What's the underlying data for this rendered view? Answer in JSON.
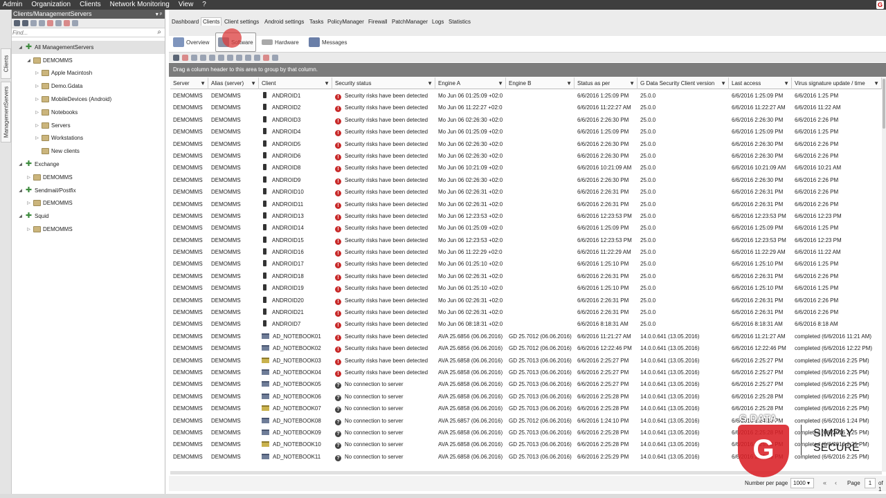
{
  "menubar": {
    "items": [
      "Admin",
      "Organization",
      "Clients",
      "Network Monitoring",
      "View",
      "?"
    ],
    "logo": "G"
  },
  "vtabs": [
    "Clients",
    "ManagementServers"
  ],
  "left_panel": {
    "title": "Clients/ManagementServers",
    "pin": "▾ ᵖ",
    "search_placeholder": "Find...",
    "tree": [
      {
        "label": "All ManagementServers",
        "depth": 0,
        "icon": "network-icon",
        "exp": "◢",
        "selected": true
      },
      {
        "label": "DEMOMMS",
        "depth": 1,
        "icon": "folder-icon",
        "exp": "◢"
      },
      {
        "label": "Apple Macintosh",
        "depth": 2,
        "icon": "folder-icon",
        "exp": "▷"
      },
      {
        "label": "Demo.Gdata",
        "depth": 2,
        "icon": "folder-icon",
        "exp": "▷"
      },
      {
        "label": "MobileDevices (Android)",
        "depth": 2,
        "icon": "folder-icon",
        "exp": "▷"
      },
      {
        "label": "Notebooks",
        "depth": 2,
        "icon": "folder-icon",
        "exp": "▷"
      },
      {
        "label": "Servers",
        "depth": 2,
        "icon": "folder-icon",
        "exp": "▷"
      },
      {
        "label": "Workstations",
        "depth": 2,
        "icon": "folder-icon",
        "exp": "▷"
      },
      {
        "label": "New clients",
        "depth": 2,
        "icon": "folder-icon",
        "exp": ""
      },
      {
        "label": "Exchange",
        "depth": 0,
        "icon": "network-icon",
        "exp": "◢"
      },
      {
        "label": "DEMOMMS",
        "depth": 1,
        "icon": "folder-icon",
        "exp": "▷"
      },
      {
        "label": "Sendmail/Postfix",
        "depth": 0,
        "icon": "network-icon",
        "exp": "◢"
      },
      {
        "label": "DEMOMMS",
        "depth": 1,
        "icon": "folder-icon",
        "exp": "▷"
      },
      {
        "label": "Squid",
        "depth": 0,
        "icon": "network-icon",
        "exp": "◢"
      },
      {
        "label": "DEMOMMS",
        "depth": 1,
        "icon": "folder-icon",
        "exp": "▷"
      }
    ]
  },
  "top_tabs": [
    "Dashboard",
    "Clients",
    "Client settings",
    "Android settings",
    "Tasks",
    "PolicyManager",
    "Firewall",
    "PatchManager",
    "Logs",
    "Statistics"
  ],
  "active_top_tab": "Clients",
  "sub_tabs": [
    "Overview",
    "Software",
    "Hardware",
    "Messages"
  ],
  "active_sub_tab": "Software",
  "group_bar": "Drag a column header to this area to group by that column.",
  "columns": [
    "Server",
    "Alias (server)",
    "Client",
    "Security status",
    "Engine A",
    "Engine B",
    "Status as per",
    "G Data Security Client version",
    "Last access",
    "Virus signature update / time"
  ],
  "rows": [
    [
      "DEMOMMS",
      "DEMOMMS",
      "ANDROID1",
      "Security risks have been detected",
      "Mo Jun 06 01:25:09 +02:0",
      "",
      "6/6/2016 1:25:09 PM",
      "25.0.0",
      "6/6/2016 1:25:09 PM",
      "6/6/2016 1:25 PM",
      "phone",
      "risk"
    ],
    [
      "DEMOMMS",
      "DEMOMMS",
      "ANDROID2",
      "Security risks have been detected",
      "Mo Jun 06 11:22:27 +02:0",
      "",
      "6/6/2016 11:22:27 AM",
      "25.0.0",
      "6/6/2016 11:22:27 AM",
      "6/6/2016 11:22 AM",
      "phone",
      "risk"
    ],
    [
      "DEMOMMS",
      "DEMOMMS",
      "ANDROID3",
      "Security risks have been detected",
      "Mo Jun 06 02:26:30 +02:0",
      "",
      "6/6/2016 2:26:30 PM",
      "25.0.0",
      "6/6/2016 2:26:30 PM",
      "6/6/2016 2:26 PM",
      "phone",
      "risk"
    ],
    [
      "DEMOMMS",
      "DEMOMMS",
      "ANDROID4",
      "Security risks have been detected",
      "Mo Jun 06 01:25:09 +02:0",
      "",
      "6/6/2016 1:25:09 PM",
      "25.0.0",
      "6/6/2016 1:25:09 PM",
      "6/6/2016 1:25 PM",
      "phone",
      "risk"
    ],
    [
      "DEMOMMS",
      "DEMOMMS",
      "ANDROID5",
      "Security risks have been detected",
      "Mo Jun 06 02:26:30 +02:0",
      "",
      "6/6/2016 2:26:30 PM",
      "25.0.0",
      "6/6/2016 2:26:30 PM",
      "6/6/2016 2:26 PM",
      "phone",
      "risk"
    ],
    [
      "DEMOMMS",
      "DEMOMMS",
      "ANDROID6",
      "Security risks have been detected",
      "Mo Jun 06 02:26:30 +02:0",
      "",
      "6/6/2016 2:26:30 PM",
      "25.0.0",
      "6/6/2016 2:26:30 PM",
      "6/6/2016 2:26 PM",
      "phone",
      "risk"
    ],
    [
      "DEMOMMS",
      "DEMOMMS",
      "ANDROID8",
      "Security risks have been detected",
      "Mo Jun 06 10:21:09 +02:0",
      "",
      "6/6/2016 10:21:09 AM",
      "25.0.0",
      "6/6/2016 10:21:09 AM",
      "6/6/2016 10:21 AM",
      "phone",
      "risk"
    ],
    [
      "DEMOMMS",
      "DEMOMMS",
      "ANDROID9",
      "Security risks have been detected",
      "Mo Jun 06 02:26:30 +02:0",
      "",
      "6/6/2016 2:26:30 PM",
      "25.0.0",
      "6/6/2016 2:26:30 PM",
      "6/6/2016 2:26 PM",
      "phone",
      "risk"
    ],
    [
      "DEMOMMS",
      "DEMOMMS",
      "ANDROID10",
      "Security risks have been detected",
      "Mo Jun 06 02:26:31 +02:0",
      "",
      "6/6/2016 2:26:31 PM",
      "25.0.0",
      "6/6/2016 2:26:31 PM",
      "6/6/2016 2:26 PM",
      "phone",
      "risk"
    ],
    [
      "DEMOMMS",
      "DEMOMMS",
      "ANDROID11",
      "Security risks have been detected",
      "Mo Jun 06 02:26:31 +02:0",
      "",
      "6/6/2016 2:26:31 PM",
      "25.0.0",
      "6/6/2016 2:26:31 PM",
      "6/6/2016 2:26 PM",
      "phone",
      "risk"
    ],
    [
      "DEMOMMS",
      "DEMOMMS",
      "ANDROID13",
      "Security risks have been detected",
      "Mo Jun 06 12:23:53 +02:0",
      "",
      "6/6/2016 12:23:53 PM",
      "25.0.0",
      "6/6/2016 12:23:53 PM",
      "6/6/2016 12:23 PM",
      "phone",
      "risk"
    ],
    [
      "DEMOMMS",
      "DEMOMMS",
      "ANDROID14",
      "Security risks have been detected",
      "Mo Jun 06 01:25:09 +02:0",
      "",
      "6/6/2016 1:25:09 PM",
      "25.0.0",
      "6/6/2016 1:25:09 PM",
      "6/6/2016 1:25 PM",
      "phone",
      "risk"
    ],
    [
      "DEMOMMS",
      "DEMOMMS",
      "ANDROID15",
      "Security risks have been detected",
      "Mo Jun 06 12:23:53 +02:0",
      "",
      "6/6/2016 12:23:53 PM",
      "25.0.0",
      "6/6/2016 12:23:53 PM",
      "6/6/2016 12:23 PM",
      "phone",
      "risk"
    ],
    [
      "DEMOMMS",
      "DEMOMMS",
      "ANDROID16",
      "Security risks have been detected",
      "Mo Jun 06 11:22:29 +02:0",
      "",
      "6/6/2016 11:22:29 AM",
      "25.0.0",
      "6/6/2016 11:22:29 AM",
      "6/6/2016 11:22 AM",
      "phone",
      "risk"
    ],
    [
      "DEMOMMS",
      "DEMOMMS",
      "ANDROID17",
      "Security risks have been detected",
      "Mo Jun 06 01:25:10 +02:0",
      "",
      "6/6/2016 1:25:10 PM",
      "25.0.0",
      "6/6/2016 1:25:10 PM",
      "6/6/2016 1:25 PM",
      "phone",
      "risk"
    ],
    [
      "DEMOMMS",
      "DEMOMMS",
      "ANDROID18",
      "Security risks have been detected",
      "Mo Jun 06 02:26:31 +02:0",
      "",
      "6/6/2016 2:26:31 PM",
      "25.0.0",
      "6/6/2016 2:26:31 PM",
      "6/6/2016 2:26 PM",
      "phone",
      "risk"
    ],
    [
      "DEMOMMS",
      "DEMOMMS",
      "ANDROID19",
      "Security risks have been detected",
      "Mo Jun 06 01:25:10 +02:0",
      "",
      "6/6/2016 1:25:10 PM",
      "25.0.0",
      "6/6/2016 1:25:10 PM",
      "6/6/2016 1:25 PM",
      "phone",
      "risk"
    ],
    [
      "DEMOMMS",
      "DEMOMMS",
      "ANDROID20",
      "Security risks have been detected",
      "Mo Jun 06 02:26:31 +02:0",
      "",
      "6/6/2016 2:26:31 PM",
      "25.0.0",
      "6/6/2016 2:26:31 PM",
      "6/6/2016 2:26 PM",
      "phone",
      "risk"
    ],
    [
      "DEMOMMS",
      "DEMOMMS",
      "ANDROID21",
      "Security risks have been detected",
      "Mo Jun 06 02:26:31 +02:0",
      "",
      "6/6/2016 2:26:31 PM",
      "25.0.0",
      "6/6/2016 2:26:31 PM",
      "6/6/2016 2:26 PM",
      "phone",
      "risk"
    ],
    [
      "DEMOMMS",
      "DEMOMMS",
      "ANDROID7",
      "Security risks have been detected",
      "Mo Jun 06 08:18:31 +02:0",
      "",
      "6/6/2016 8:18:31 AM",
      "25.0.0",
      "6/6/2016 8:18:31 AM",
      "6/6/2016 8:18 AM",
      "phone",
      "risk"
    ],
    [
      "DEMOMMS",
      "DEMOMMS",
      "AD_NOTEBOOK01",
      "Security risks have been detected",
      "AVA 25.6856 (06.06.2016)",
      "GD 25.7012 (06.06.2016)",
      "6/6/2016 11:21:27 AM",
      "14.0.0.641 (13.05.2016)",
      "6/6/2016 11:21:27 AM",
      "completed (6/6/2016 11:21 AM)",
      "laptop",
      "risk"
    ],
    [
      "DEMOMMS",
      "DEMOMMS",
      "AD_NOTEBOOK02",
      "Security risks have been detected",
      "AVA 25.6856 (06.06.2016)",
      "GD 25.7012 (06.06.2016)",
      "6/6/2016 12:22:46 PM",
      "14.0.0.641 (13.05.2016)",
      "6/6/2016 12:22:46 PM",
      "completed (6/6/2016 12:22 PM)",
      "laptop",
      "risk"
    ],
    [
      "DEMOMMS",
      "DEMOMMS",
      "AD_NOTEBOOK03",
      "Security risks have been detected",
      "AVA 25.6858 (06.06.2016)",
      "GD 25.7013 (06.06.2016)",
      "6/6/2016 2:25:27 PM",
      "14.0.0.641 (13.05.2016)",
      "6/6/2016 2:25:27 PM",
      "completed (6/6/2016 2:25 PM)",
      "laptop-y",
      "risk"
    ],
    [
      "DEMOMMS",
      "DEMOMMS",
      "AD_NOTEBOOK04",
      "Security risks have been detected",
      "AVA 25.6858 (06.06.2016)",
      "GD 25.7013 (06.06.2016)",
      "6/6/2016 2:25:27 PM",
      "14.0.0.641 (13.05.2016)",
      "6/6/2016 2:25:27 PM",
      "completed (6/6/2016 2:25 PM)",
      "laptop",
      "risk"
    ],
    [
      "DEMOMMS",
      "DEMOMMS",
      "AD_NOTEBOOK05",
      "No connection to server",
      "AVA 25.6858 (06.06.2016)",
      "GD 25.7013 (06.06.2016)",
      "6/6/2016 2:25:27 PM",
      "14.0.0.641 (13.05.2016)",
      "6/6/2016 2:25:27 PM",
      "completed (6/6/2016 2:25 PM)",
      "laptop",
      "none"
    ],
    [
      "DEMOMMS",
      "DEMOMMS",
      "AD_NOTEBOOK06",
      "No connection to server",
      "AVA 25.6858 (06.06.2016)",
      "GD 25.7013 (06.06.2016)",
      "6/6/2016 2:25:28 PM",
      "14.0.0.641 (13.05.2016)",
      "6/6/2016 2:25:28 PM",
      "completed (6/6/2016 2:25 PM)",
      "laptop",
      "none"
    ],
    [
      "DEMOMMS",
      "DEMOMMS",
      "AD_NOTEBOOK07",
      "No connection to server",
      "AVA 25.6858 (06.06.2016)",
      "GD 25.7013 (06.06.2016)",
      "6/6/2016 2:25:28 PM",
      "14.0.0.641 (13.05.2016)",
      "6/6/2016 2:25:28 PM",
      "completed (6/6/2016 2:25 PM)",
      "laptop-y",
      "none"
    ],
    [
      "DEMOMMS",
      "DEMOMMS",
      "AD_NOTEBOOK08",
      "No connection to server",
      "AVA 25.6857 (06.06.2016)",
      "GD 25.7012 (06.06.2016)",
      "6/6/2016 1:24:10 PM",
      "14.0.0.641 (13.05.2016)",
      "6/6/2016 1:24:10 PM",
      "completed (6/6/2016 1:24 PM)",
      "laptop",
      "none"
    ],
    [
      "DEMOMMS",
      "DEMOMMS",
      "AD_NOTEBOOK09",
      "No connection to server",
      "AVA 25.6858 (06.06.2016)",
      "GD 25.7013 (06.06.2016)",
      "6/6/2016 2:25:28 PM",
      "14.0.0.641 (13.05.2016)",
      "6/6/2016 2:25:28 PM",
      "completed (6/6/2016 2:25 PM)",
      "laptop",
      "none"
    ],
    [
      "DEMOMMS",
      "DEMOMMS",
      "AD_NOTEBOOK10",
      "No connection to server",
      "AVA 25.6858 (06.06.2016)",
      "GD 25.7013 (06.06.2016)",
      "6/6/2016 2:25:28 PM",
      "14.0.0.641 (13.05.2016)",
      "6/6/2016 2:25:28 PM",
      "completed (6/6/2016 2:25 PM)",
      "laptop-y",
      "none"
    ],
    [
      "DEMOMMS",
      "DEMOMMS",
      "AD_NOTEBOOK11",
      "No connection to server",
      "AVA 25.6858 (06.06.2016)",
      "GD 25.7013 (06.06.2016)",
      "6/6/2016 2:25:29 PM",
      "14.0.0.641 (13.05.2016)",
      "6/6/2016 2:25:29 PM",
      "completed (6/6/2016 2:25 PM)",
      "laptop",
      "none"
    ]
  ],
  "pager": {
    "number_per_page_label": "Number per page",
    "number_per_page_value": "1000",
    "page_label": "Page",
    "page_value": "1",
    "of_label": "of 1"
  },
  "branding": {
    "brand": "G DATA",
    "shield_letter": "G",
    "tagline_line1": "SIMPLY",
    "tagline_line2": "SECURE"
  },
  "colors": {
    "menubar": "#3e3e3e",
    "risk_red": "#c82a2a",
    "brand_red": "#da1f26",
    "group_bar": "#7c7c7c"
  }
}
